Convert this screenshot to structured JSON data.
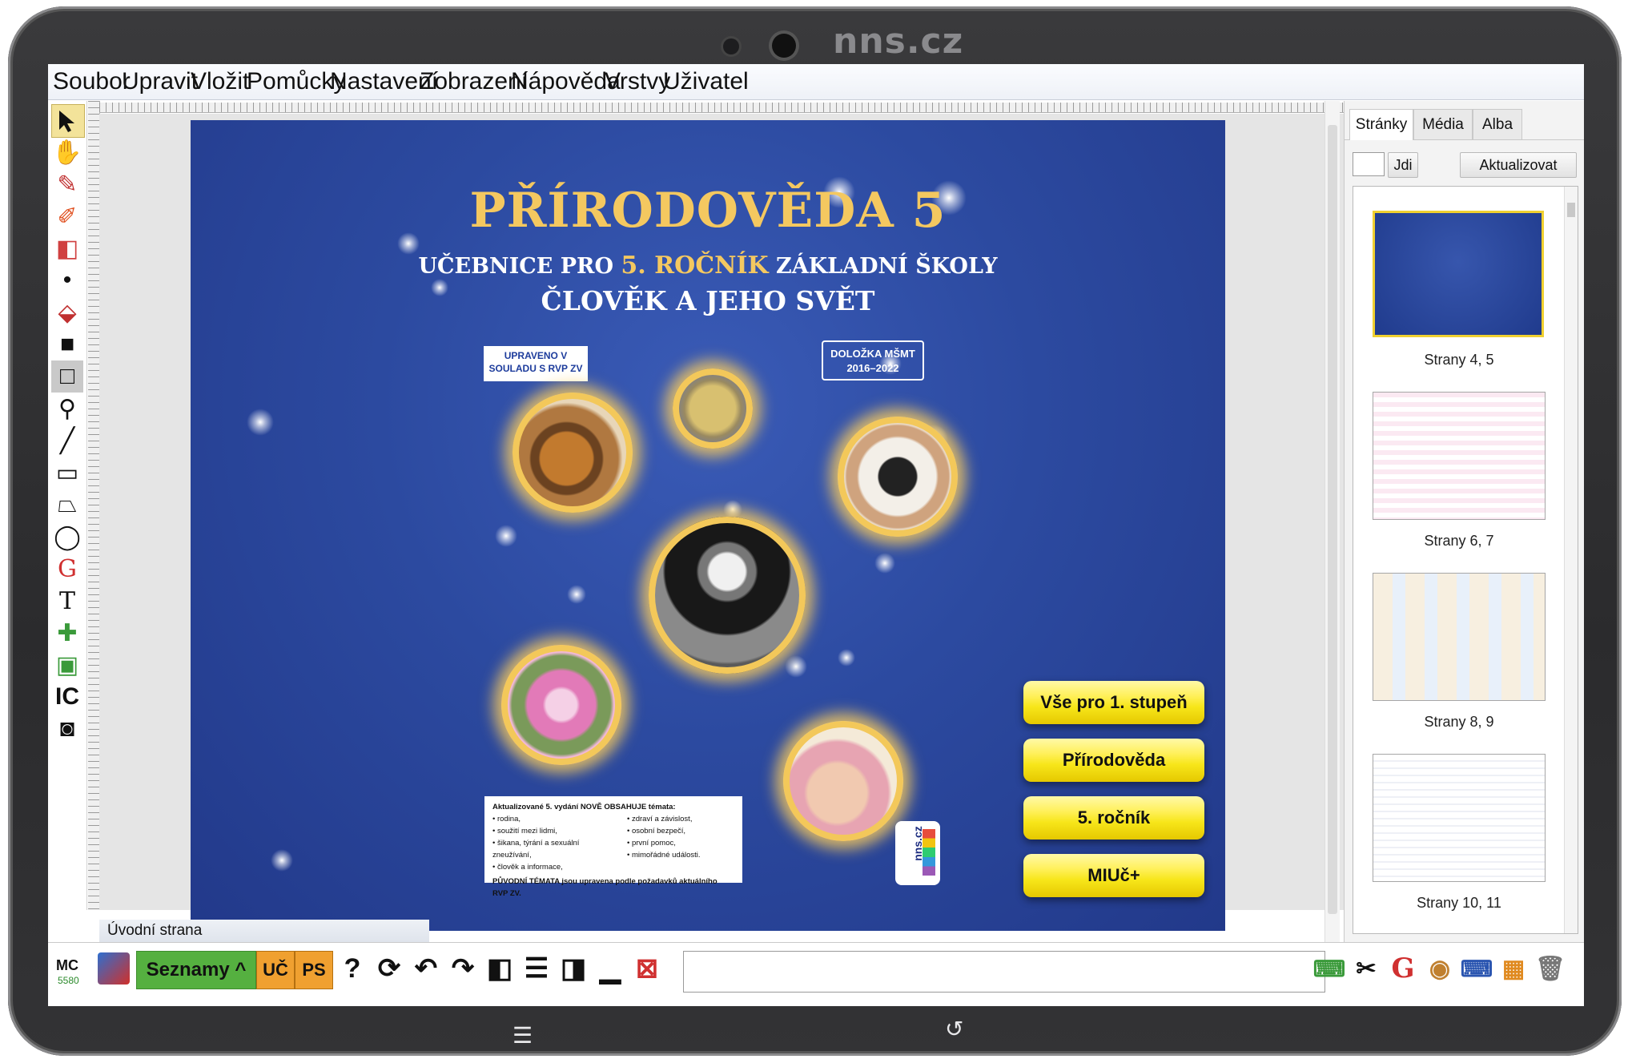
{
  "device": {
    "brand": "nns.cz"
  },
  "menu": [
    "Soubor",
    "Upravit",
    "Vložit",
    "Pomůcky",
    "Nastavení",
    "Zobrazení",
    "Nápověda",
    "Vrstvy",
    "Uživatel"
  ],
  "tools": [
    {
      "name": "select-arrow-icon",
      "glyph": "➚"
    },
    {
      "name": "hand-icon",
      "glyph": "✋"
    },
    {
      "name": "pen-icon",
      "glyph": "✎"
    },
    {
      "name": "highlighter-icon",
      "glyph": "✐"
    },
    {
      "name": "eraser-icon",
      "glyph": "⌫"
    },
    {
      "name": "dot-icon",
      "glyph": "•"
    },
    {
      "name": "fill-bucket-icon",
      "glyph": "⛽"
    },
    {
      "name": "filled-square-icon",
      "glyph": "■"
    },
    {
      "name": "outline-square-icon",
      "glyph": "□"
    },
    {
      "name": "eyedropper-icon",
      "glyph": "⚗"
    },
    {
      "name": "line-icon",
      "glyph": "╱"
    },
    {
      "name": "rectangle-icon",
      "glyph": "▭"
    },
    {
      "name": "polygon-icon",
      "glyph": "⏢"
    },
    {
      "name": "ellipse-icon",
      "glyph": "◯"
    },
    {
      "name": "geogebra-icon",
      "glyph": "G"
    },
    {
      "name": "text-icon",
      "glyph": "T"
    },
    {
      "name": "add-note-icon",
      "glyph": "✚"
    },
    {
      "name": "add-image-icon",
      "glyph": "▣"
    },
    {
      "name": "ic-icon",
      "glyph": "Ⓒ"
    },
    {
      "name": "camera-icon",
      "glyph": "📷"
    }
  ],
  "page": {
    "title": "PŘÍRODOVĚDA 5",
    "subtitle_pre": "UČEBNICE PRO ",
    "subtitle_hl": "5. ROČNÍK",
    "subtitle_post": " ZÁKLADNÍ ŠKOLY",
    "subtitle2": "ČLOVĚK A JEHO SVĚT",
    "badge_rvp": "UPRAVENO V SOULADU S RVP ZV",
    "badge_dolozka_1": "DOLOŽKA MŠMT",
    "badge_dolozka_2": "2016–2022",
    "info_header": "Aktualizované 5. vydání NOVĚ OBSAHUJE témata:",
    "info_left": [
      "• rodina,",
      "• soužití mezi lidmi,",
      "• šikana, týrání a sexuální zneužívání,",
      "• člověk a informace,"
    ],
    "info_right": [
      "• zdraví a závislost,",
      "• osobní bezpečí,",
      "• první pomoc,",
      "• mimořádné události."
    ],
    "info_footer": "PŮVODNÍ TÉMATA jsou upravena podle požadavků aktuálního RVP ZV.",
    "logo": "nns.cz",
    "buttons": [
      "Vše pro 1. stupeň",
      "Přírodověda",
      "5. ročník",
      "MIUč+"
    ]
  },
  "side": {
    "tabs": [
      "Stránky",
      "Média",
      "Alba"
    ],
    "go_label": "Jdi",
    "refresh_label": "Aktualizovat",
    "thumbnails": [
      {
        "caption": "Strany 4, 5",
        "style": "cover"
      },
      {
        "caption": "Strany 6, 7",
        "style": "pink"
      },
      {
        "caption": "Strany 8, 9",
        "style": "color"
      },
      {
        "caption": "Strany 10, 11",
        "style": "white"
      }
    ]
  },
  "status": {
    "page_name": "Úvodní strana"
  },
  "bottom": {
    "mc": "MC",
    "mc_number": "5580",
    "seznamy": "Seznamy ^",
    "uc": "UČ",
    "ps": "PS"
  }
}
